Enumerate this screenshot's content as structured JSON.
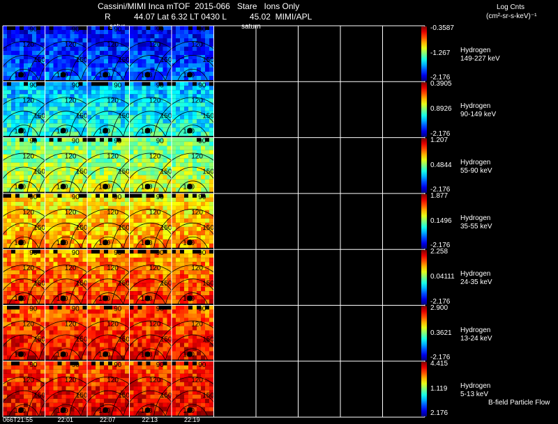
{
  "header": {
    "title": "Cassini/MIMI Inca mTOF  2015-066   Stare   Ions Only",
    "subtitle": "R          44.07 Lat 6.32 LT 0430 L          45.02  MIMI/APL",
    "units_line1": "Log Cnts",
    "units_line2": "(cm²-sr-s-keV)⁻¹",
    "saturn_labels": [
      "satur",
      "saturn"
    ]
  },
  "panel_labels": [
    "90",
    "120",
    "150",
    "180"
  ],
  "rows": [
    {
      "species": "Hydrogen",
      "energy": "149-227 keV",
      "max": "-0.3587",
      "mid": "-1.267",
      "min": "-2.176",
      "level": 0.12
    },
    {
      "species": "Hydrogen",
      "energy": "90-149 keV",
      "max": "0.3905",
      "mid": "0.8926",
      "min": "-2.176",
      "level": 0.3
    },
    {
      "species": "Hydrogen",
      "energy": "55-90 keV",
      "max": "1.207",
      "mid": "0.4844",
      "min": "-2.176",
      "level": 0.48
    },
    {
      "species": "Hydrogen",
      "energy": "35-55 keV",
      "max": "1.877",
      "mid": "0.1496",
      "min": "-2.176",
      "level": 0.62
    },
    {
      "species": "Hydrogen",
      "energy": "24-35 keV",
      "max": "2.258",
      "mid": "0.04111",
      "min": "-2.176",
      "level": 0.72
    },
    {
      "species": "Hydrogen",
      "energy": "13-24 keV",
      "max": "2.900",
      "mid": "0.3621",
      "min": "-2.176",
      "level": 0.78
    },
    {
      "species": "Hydrogen",
      "energy": "5-13 keV",
      "max": "4.415",
      "mid": "1.119",
      "min": "2.176",
      "level": 0.8
    }
  ],
  "time_labels": [
    "066T21:55",
    "22:01",
    "22:07",
    "22:13",
    "22:19"
  ],
  "footer_note": "B-field Particle Flow"
}
